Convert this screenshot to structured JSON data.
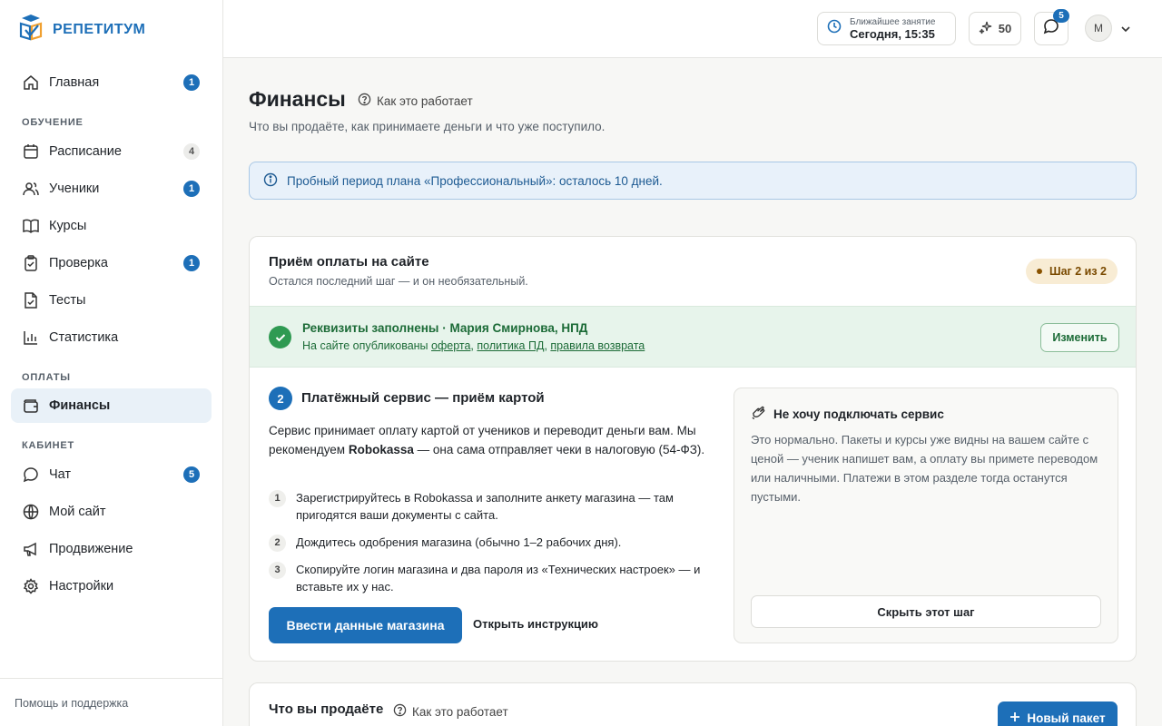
{
  "brand": {
    "name": "РЕПЕТИТУМ"
  },
  "sidebar": {
    "home": {
      "label": "Главная",
      "badge": "1"
    },
    "section_learning": "ОБУЧЕНИЕ",
    "schedule": {
      "label": "Расписание",
      "badge": "4"
    },
    "students": {
      "label": "Ученики",
      "badge": "1"
    },
    "courses": {
      "label": "Курсы"
    },
    "review": {
      "label": "Проверка",
      "badge": "1"
    },
    "tests": {
      "label": "Тесты"
    },
    "stats": {
      "label": "Статистика"
    },
    "section_payments": "ОПЛАТЫ",
    "finance": {
      "label": "Финансы"
    },
    "section_cabinet": "КАБИНЕТ",
    "chat": {
      "label": "Чат",
      "badge": "5"
    },
    "site": {
      "label": "Мой сайт"
    },
    "promo": {
      "label": "Продвижение"
    },
    "settings": {
      "label": "Настройки"
    },
    "help": "Помощь и поддержка"
  },
  "header": {
    "next_lesson_label": "Ближайшее занятие",
    "next_lesson_time": "Сегодня, 15:35",
    "points": "50",
    "chat_count": "5",
    "avatar_initial": "М"
  },
  "page": {
    "title": "Финансы",
    "how_link": "Как это работает",
    "subtitle": "Что вы продаёте, как принимаете деньги и что уже поступило.",
    "trial_notice": "Пробный период плана «Профессиональный»: осталось 10 дней."
  },
  "payment_card": {
    "title": "Приём оплаты на сайте",
    "subtitle": "Остался последний шаг — и он необязательный.",
    "step_pill": "Шаг 2 из 2",
    "requisites": {
      "title": "Реквизиты заполнены · Мария Смирнова, НПД",
      "text_prefix": "На сайте опубликованы ",
      "link_offer": "оферта",
      "sep1": ", ",
      "link_privacy": "политика ПД",
      "sep2": ", ",
      "link_refund": "правила возврата",
      "edit_button": "Изменить"
    },
    "step": {
      "number": "2",
      "title": "Платёжный сервис — приём картой",
      "desc_prefix": "Сервис принимает оплату картой от учеников и переводит деньги вам. Мы рекомендуем ",
      "desc_bold": "Robokassa",
      "desc_suffix": " — она сама отправляет чеки в налоговую (54-ФЗ).",
      "items": [
        {
          "n": "1",
          "text": "Зарегистрируйтесь в Robokassa и заполните анкету магазина — там пригодятся ваши документы с сайта."
        },
        {
          "n": "2",
          "text": "Дождитесь одобрения магазина (обычно 1–2 рабочих дня)."
        },
        {
          "n": "3",
          "text": "Скопируйте логин магазина и два пароля из «Технических настроек» — и вставьте их у нас."
        }
      ],
      "primary_button": "Ввести данные магазина",
      "secondary_link": "Открыть инструкцию"
    },
    "skip_panel": {
      "title": "Не хочу подключать сервис",
      "text": "Это нормально. Пакеты и курсы уже видны на вашем сайте с ценой — ученик напишет вам, а оплату вы примете переводом или наличными. Платежи в этом разделе тогда останутся пустыми.",
      "button": "Скрыть этот шаг"
    }
  },
  "sell_card": {
    "title": "Что вы продаёте",
    "how_link": "Как это работает",
    "new_button": "Новый пакет"
  },
  "colors": {
    "accent": "#1d6fb8",
    "success": "#2f9a52",
    "warning_bg": "#f8ecd4"
  }
}
